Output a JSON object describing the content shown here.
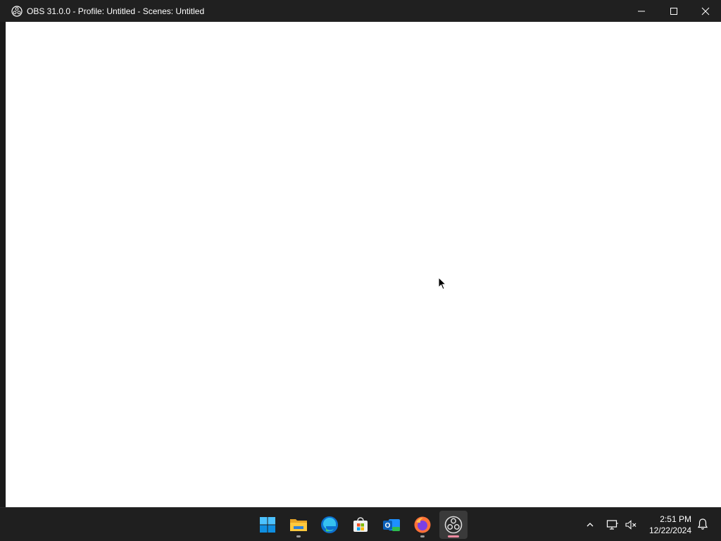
{
  "window": {
    "title": "OBS 31.0.0 - Profile: Untitled - Scenes: Untitled",
    "app_icon": "obs-logo-icon",
    "caption_buttons": [
      "minimize-icon",
      "maximize-icon",
      "close-icon"
    ]
  },
  "taskbar": {
    "apps": [
      {
        "name": "start",
        "icon": "windows-start-icon",
        "running": false
      },
      {
        "name": "file-explorer",
        "icon": "folder-icon",
        "running": true
      },
      {
        "name": "edge",
        "icon": "edge-browser-icon",
        "running": false
      },
      {
        "name": "microsoft-store",
        "icon": "store-icon",
        "running": false
      },
      {
        "name": "outlook-new",
        "icon": "outlook-icon",
        "running": false
      },
      {
        "name": "firefox",
        "icon": "firefox-icon",
        "running": true
      },
      {
        "name": "obs-studio",
        "icon": "obs-logo-icon",
        "running": true,
        "active": true
      }
    ],
    "tray": {
      "icons": [
        "chevron-up-icon",
        "network-icon",
        "volume-muted-icon"
      ],
      "time": "2:51 PM",
      "date": "12/22/2024",
      "notification_icon": "bell-icon"
    }
  },
  "colors": {
    "titlebar_bg": "#202020",
    "taskbar_bg": "#1f1f1f",
    "canvas_bg": "#ffffff",
    "active_indicator": "#f08aa0"
  }
}
